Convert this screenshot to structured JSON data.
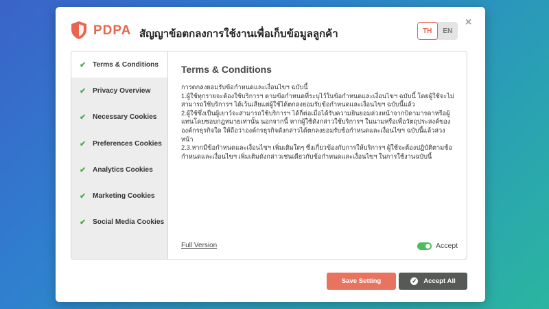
{
  "header": {
    "brand": "PDPA",
    "title": "สัญญาข้อตกลงการใช้งานเพื่อเก็บข้อมูลลูกค้า",
    "lang_th": "TH",
    "lang_en": "EN",
    "close_glyph": "×"
  },
  "sidebar": {
    "items": [
      {
        "label": "Terms & Conditions"
      },
      {
        "label": "Privacy Overview"
      },
      {
        "label": "Necessary Cookies"
      },
      {
        "label": "Preferences Cookies"
      },
      {
        "label": "Analytics Cookies"
      },
      {
        "label": "Marketing Cookies"
      },
      {
        "label": "Social Media Cookies"
      }
    ]
  },
  "content": {
    "title": "Terms & Conditions",
    "paragraphs": [
      "การตกลงยอมรับข้อกำหนดและเงื่อนไขฯ ฉบับนี้",
      "1.ผู้ใช้ทุกรายจะต้องใช้บริการฯ ตามข้อกำหนดที่ระบุไว้ในข้อกำหนดและเงื่อนไขฯ ฉบับนี้ โดยผู้ใช้จะไม่สามารถใช้บริการฯ ได้เว้นเสียแต่ผู้ใช้ได้ตกลงยอมรับข้อกำหนดและเงื่อนไขฯ ฉบับนี้แล้ว",
      "2.ผู้ใช้ซึ่งเป็นผู้เยาว์จะสามารถใช้บริการฯ ได้ก็ต่อเมื่อได้รับความยินยอมล่วงหน้าจากบิดามารดาหรือผู้แทนโดยชอบกฎหมายเท่านั้น นอกจากนี้ หากผู้ใช้ดังกล่าวใช้บริการฯ ในนามหรือเพื่อวัตถุประสงค์ขององค์กรธุรกิจใด ให้ถือว่าองค์กรธุรกิจดังกล่าวได้ตกลงยอมรับข้อกำหนดและเงื่อนไขฯ ฉบับนี้แล้วล่วงหน้า",
      "2.3.หากมีข้อกำหนดและเงื่อนไขฯ เพิ่มเติมใดๆ ซึ่งเกี่ยวข้องกับการให้บริการฯ ผู้ใช้จะต้องปฏิบัติตามข้อกำหนดและเงื่อนไขฯ เพิ่มเติมดังกล่าวเช่นเดียวกับข้อกำหนดและเงื่อนไขฯ ในการใช้งานฉบับนี้"
    ],
    "full_version_link": "Full Version",
    "accept_label": "Accept",
    "accept_on": true
  },
  "buttons": {
    "save_setting": "Save Setting",
    "accept_all": "Accept All"
  },
  "colors": {
    "accent": "#e8664f",
    "check_green": "#4aa84a",
    "toggle_green": "#4cbc5c",
    "accept_all_bg": "#555a56"
  },
  "icons": {
    "logo": "shield-icon",
    "check": "check-icon",
    "close": "close-icon"
  }
}
